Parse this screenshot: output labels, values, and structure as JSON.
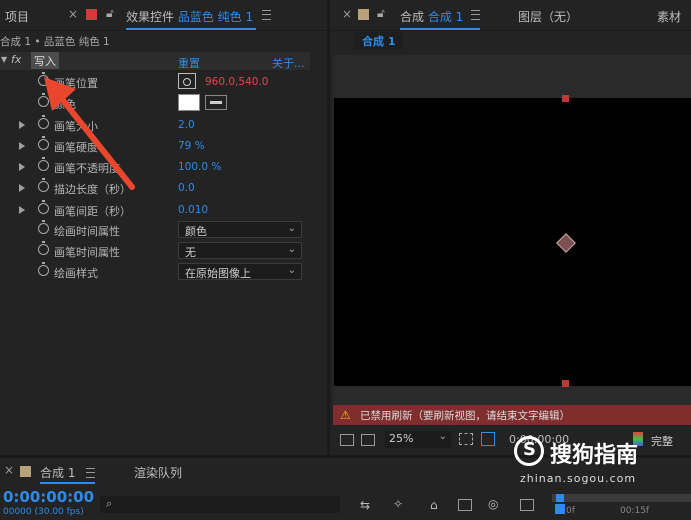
{
  "left_panel": {
    "project_tab": "项目",
    "effects_tab_prefix": "效果控件",
    "effects_tab_layer": "品蓝色 纯色 1",
    "breadcrumb": "合成 1 • 品蓝色 纯色 1",
    "fx_label": "fx",
    "effect_name": "写入",
    "reset_label": "重置",
    "about_label": "关于...",
    "properties": [
      {
        "name": "画笔位置",
        "value": "960.0,540.0"
      },
      {
        "name": "颜色",
        "value": ""
      },
      {
        "name": "画笔大小",
        "value": "2.0"
      },
      {
        "name": "画笔硬度",
        "value": "79 %"
      },
      {
        "name": "画笔不透明度",
        "value": "100.0 %"
      },
      {
        "name": "描边长度（秒）",
        "value": "0.0"
      },
      {
        "name": "画笔间距（秒）",
        "value": "0.010"
      },
      {
        "name": "绘画时间属性",
        "value": "颜色"
      },
      {
        "name": "画笔时间属性",
        "value": "无"
      },
      {
        "name": "绘画样式",
        "value": "在原始图像上"
      }
    ]
  },
  "right_panel": {
    "comp_tab_prefix": "合成",
    "comp_tab_name": "合成 1",
    "layer_tab": "图层（无）",
    "footage_tab": "素材",
    "comp_chip": "合成 1",
    "warning": "已禁用刷新（要刷新视图，请结束文字编辑）",
    "zoom": "25%",
    "timecode_small": "0:00:00:00",
    "quality": "完整"
  },
  "bottom": {
    "comp_tab": "合成 1",
    "render_tab": "渲染队列",
    "timecode": "0:00:00:00",
    "fps": "00000 (30.00 fps)",
    "ruler_end": "00:15f",
    "ruler_start": "0f"
  },
  "watermark": {
    "brand": "搜狗指南",
    "url": "zhinan.sogou.com"
  },
  "colors": {
    "accent": "#2d8ceb",
    "value_red": "#e0464e",
    "arrow": "#e8472e",
    "swatch_red": "#d33a3a",
    "swatch_tan": "#b9a27a"
  }
}
